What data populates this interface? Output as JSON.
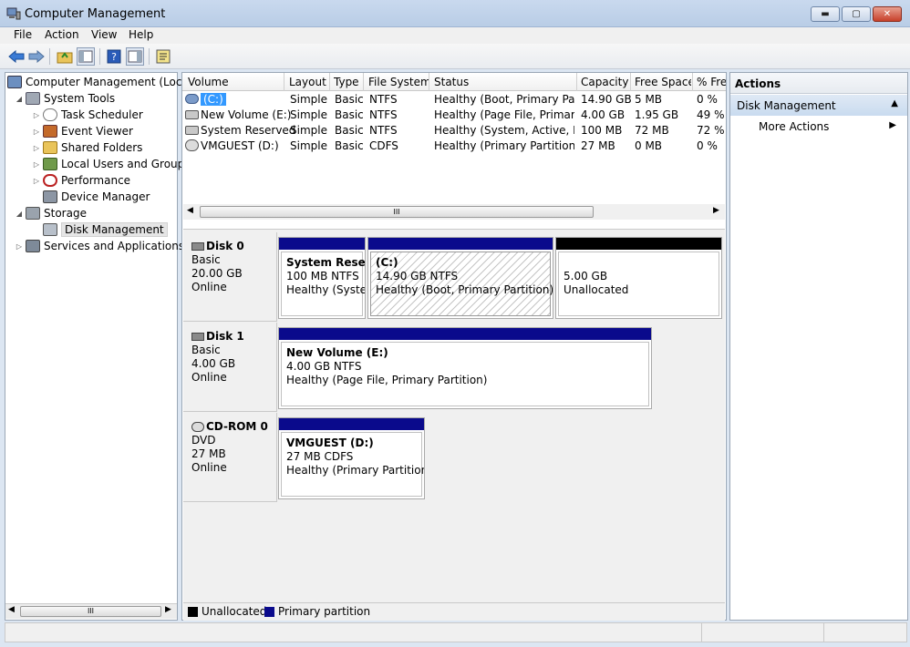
{
  "window": {
    "title": "Computer Management",
    "min": "▬",
    "max": "▢",
    "close": "✕"
  },
  "menu": [
    "File",
    "Action",
    "View",
    "Help"
  ],
  "tree": {
    "root": "Computer Management (Local",
    "system_tools": "System Tools",
    "task_scheduler": "Task Scheduler",
    "event_viewer": "Event Viewer",
    "shared_folders": "Shared Folders",
    "local_users": "Local Users and Groups",
    "performance": "Performance",
    "device_manager": "Device Manager",
    "storage": "Storage",
    "disk_management": "Disk Management",
    "services": "Services and Applications",
    "scroll_grip": "III"
  },
  "volumes": {
    "headers": [
      "Volume",
      "Layout",
      "Type",
      "File System",
      "Status",
      "Capacity",
      "Free Space",
      "% Fre"
    ],
    "rows": [
      [
        "(C:)",
        "Simple",
        "Basic",
        "NTFS",
        "Healthy (Boot, Primary Par...",
        "14.90 GB",
        "5 MB",
        "0 %"
      ],
      [
        "New Volume (E:)",
        "Simple",
        "Basic",
        "NTFS",
        "Healthy (Page File, Primar...",
        "4.00 GB",
        "1.95 GB",
        "49 %"
      ],
      [
        "System Reserved",
        "Simple",
        "Basic",
        "NTFS",
        "Healthy (System, Active, P...",
        "100 MB",
        "72 MB",
        "72 %"
      ],
      [
        "VMGUEST (D:)",
        "Simple",
        "Basic",
        "CDFS",
        "Healthy (Primary Partition)",
        "27 MB",
        "0 MB",
        "0 %"
      ]
    ],
    "scroll_grip": "III"
  },
  "disks": [
    {
      "name": "Disk 0",
      "type": "Basic",
      "size": "20.00 GB",
      "state": "Online",
      "parts": [
        {
          "title": "System Reserv",
          "size": "100 MB NTFS",
          "status": "Healthy (System"
        },
        {
          "title": "(C:)",
          "size": "14.90 GB NTFS",
          "status": "Healthy (Boot, Primary Partition)"
        },
        {
          "title": "",
          "size": "5.00 GB",
          "status": "Unallocated"
        }
      ]
    },
    {
      "name": "Disk 1",
      "type": "Basic",
      "size": "4.00 GB",
      "state": "Online",
      "parts": [
        {
          "title": "New Volume  (E:)",
          "size": "4.00 GB NTFS",
          "status": "Healthy (Page File, Primary Partition)"
        }
      ]
    },
    {
      "name": "CD-ROM 0",
      "type": "DVD",
      "size": "27 MB",
      "state": "Online",
      "parts": [
        {
          "title": "VMGUEST  (D:)",
          "size": "27 MB CDFS",
          "status": "Healthy (Primary Partition)"
        }
      ]
    }
  ],
  "legend": {
    "unallocated": "Unallocated",
    "primary": "Primary partition"
  },
  "actions": {
    "title": "Actions",
    "section": "Disk Management",
    "more": "More Actions"
  },
  "colors": {
    "primary_bar": "#0a0a8c",
    "unallocated_bar": "#000000",
    "selection": "#3399ff"
  }
}
